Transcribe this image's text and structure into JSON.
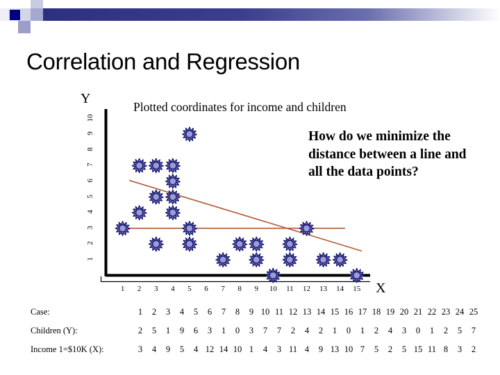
{
  "slide": {
    "title": "Correlation and Regression"
  },
  "decor": {
    "bar_color_dark": "#2b2f7e",
    "square_navy": "#000080",
    "square_mid": "#9a9ec8",
    "square_light": "#c8cbe2",
    "square_pale": "#e2e3f0"
  },
  "chart_caption": "Plotted coordinates for income and children",
  "question": "How do we minimize the distance between a line and all the data points?",
  "chart_data": {
    "type": "scatter",
    "title": "Plotted coordinates for income and children",
    "xlabel": "X",
    "ylabel": "Y",
    "xlim": [
      0,
      15.8
    ],
    "ylim": [
      0,
      10.6
    ],
    "grid": false,
    "legend": "none",
    "marker_fill": "#9b9bd8",
    "marker_stroke": "#191970",
    "marker_shape": "star-burst",
    "axis_color": "#000000",
    "xticks": [
      1,
      2,
      3,
      4,
      5,
      6,
      7,
      8,
      9,
      10,
      11,
      12,
      13,
      14,
      15
    ],
    "yticks": [
      1,
      2,
      3,
      4,
      5,
      6,
      7,
      8,
      9,
      10
    ],
    "x": [
      3,
      4,
      9,
      5,
      4,
      12,
      14,
      10,
      1,
      4,
      3,
      11,
      4,
      9,
      13,
      10,
      7,
      5,
      2,
      5,
      15,
      11,
      8,
      3,
      2
    ],
    "y": [
      2,
      5,
      1,
      9,
      6,
      3,
      1,
      0,
      3,
      7,
      7,
      2,
      4,
      2,
      1,
      0,
      1,
      2,
      4,
      3,
      0,
      1,
      2,
      5,
      7
    ],
    "lines": [
      {
        "name": "regression-line",
        "color": "#b05a36",
        "x0": 1.4,
        "y0": 6.05,
        "x1": 15.3,
        "y1": 1.55
      },
      {
        "name": "horizontal-mean-line",
        "color": "#b05a36",
        "x0": 1.0,
        "y0": 3.0,
        "x1": 14.3,
        "y1": 3.0
      }
    ]
  },
  "table": {
    "rows": [
      {
        "label": "Case:",
        "name": "case-row",
        "values": [
          1,
          2,
          3,
          4,
          5,
          6,
          7,
          8,
          9,
          10,
          11,
          12,
          13,
          14,
          15,
          16,
          17,
          18,
          19,
          20,
          21,
          22,
          23,
          24,
          25
        ]
      },
      {
        "label": "Children (Y):",
        "name": "children-row",
        "values": [
          2,
          5,
          1,
          9,
          6,
          3,
          1,
          0,
          3,
          7,
          7,
          2,
          4,
          2,
          1,
          0,
          1,
          2,
          4,
          3,
          0,
          1,
          2,
          5,
          7
        ]
      },
      {
        "label": "Income 1=$10K (X):",
        "name": "income-row",
        "values": [
          3,
          4,
          9,
          5,
          4,
          12,
          14,
          10,
          1,
          4,
          3,
          11,
          4,
          9,
          13,
          10,
          7,
          5,
          2,
          5,
          15,
          11,
          8,
          3,
          2
        ]
      }
    ]
  }
}
